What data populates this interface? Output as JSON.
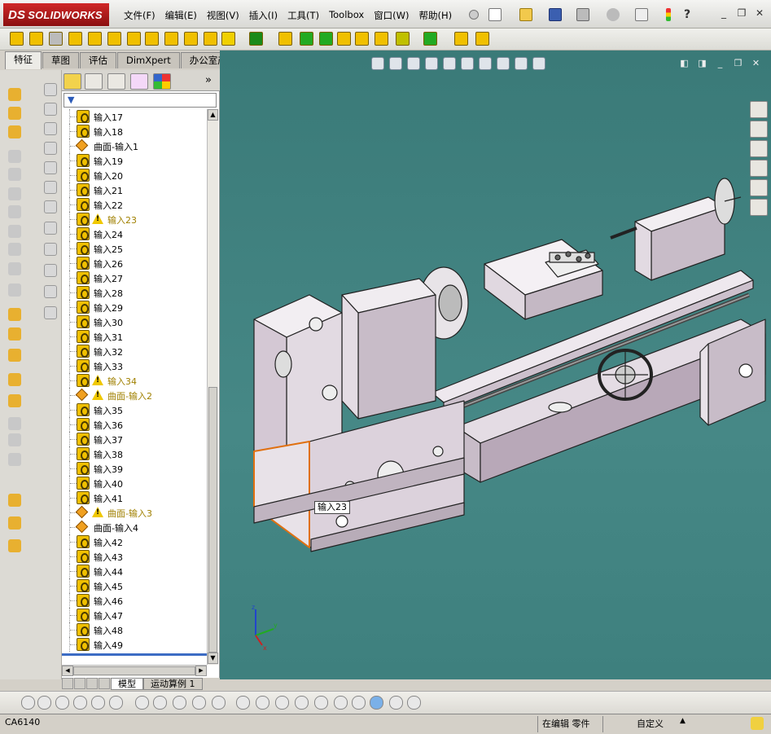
{
  "app": {
    "logo_ds": "DS",
    "logo_text": "SOLIDWORKS"
  },
  "menu": [
    "文件(F)",
    "编辑(E)",
    "视图(V)",
    "插入(I)",
    "工具(T)",
    "Toolbox",
    "窗口(W)",
    "帮助(H)"
  ],
  "tabs": [
    "特征",
    "草图",
    "评估",
    "DimXpert",
    "办公室产品"
  ],
  "feature_tree": [
    {
      "label": "输入17",
      "type": "import"
    },
    {
      "label": "输入18",
      "type": "import"
    },
    {
      "label": "曲面-输入1",
      "type": "surface"
    },
    {
      "label": "输入19",
      "type": "import"
    },
    {
      "label": "输入20",
      "type": "import"
    },
    {
      "label": "输入21",
      "type": "import"
    },
    {
      "label": "输入22",
      "type": "import"
    },
    {
      "label": "输入23",
      "type": "import",
      "warning": true
    },
    {
      "label": "输入24",
      "type": "import"
    },
    {
      "label": "输入25",
      "type": "import"
    },
    {
      "label": "输入26",
      "type": "import"
    },
    {
      "label": "输入27",
      "type": "import"
    },
    {
      "label": "输入28",
      "type": "import"
    },
    {
      "label": "输入29",
      "type": "import"
    },
    {
      "label": "输入30",
      "type": "import"
    },
    {
      "label": "输入31",
      "type": "import"
    },
    {
      "label": "输入32",
      "type": "import"
    },
    {
      "label": "输入33",
      "type": "import"
    },
    {
      "label": "输入34",
      "type": "import",
      "warning": true
    },
    {
      "label": "曲面-输入2",
      "type": "surface",
      "warning": true
    },
    {
      "label": "输入35",
      "type": "import"
    },
    {
      "label": "输入36",
      "type": "import"
    },
    {
      "label": "输入37",
      "type": "import"
    },
    {
      "label": "输入38",
      "type": "import"
    },
    {
      "label": "输入39",
      "type": "import"
    },
    {
      "label": "输入40",
      "type": "import"
    },
    {
      "label": "输入41",
      "type": "import"
    },
    {
      "label": "曲面-输入3",
      "type": "surface",
      "warning": true
    },
    {
      "label": "曲面-输入4",
      "type": "surface"
    },
    {
      "label": "输入42",
      "type": "import"
    },
    {
      "label": "输入43",
      "type": "import"
    },
    {
      "label": "输入44",
      "type": "import"
    },
    {
      "label": "输入45",
      "type": "import"
    },
    {
      "label": "输入46",
      "type": "import"
    },
    {
      "label": "输入47",
      "type": "import"
    },
    {
      "label": "输入48",
      "type": "import"
    },
    {
      "label": "输入49",
      "type": "import"
    }
  ],
  "model_tabs": [
    "模型",
    "运动算例 1"
  ],
  "tooltip": "输入23",
  "status": {
    "part_name": "CA6140",
    "editing": "在编辑 零件",
    "units": "自定义"
  },
  "colors": {
    "viewport": "#468886",
    "import_icon": "#f0c000",
    "surface_icon": "#f0a020",
    "warning_text": "#a08000"
  }
}
